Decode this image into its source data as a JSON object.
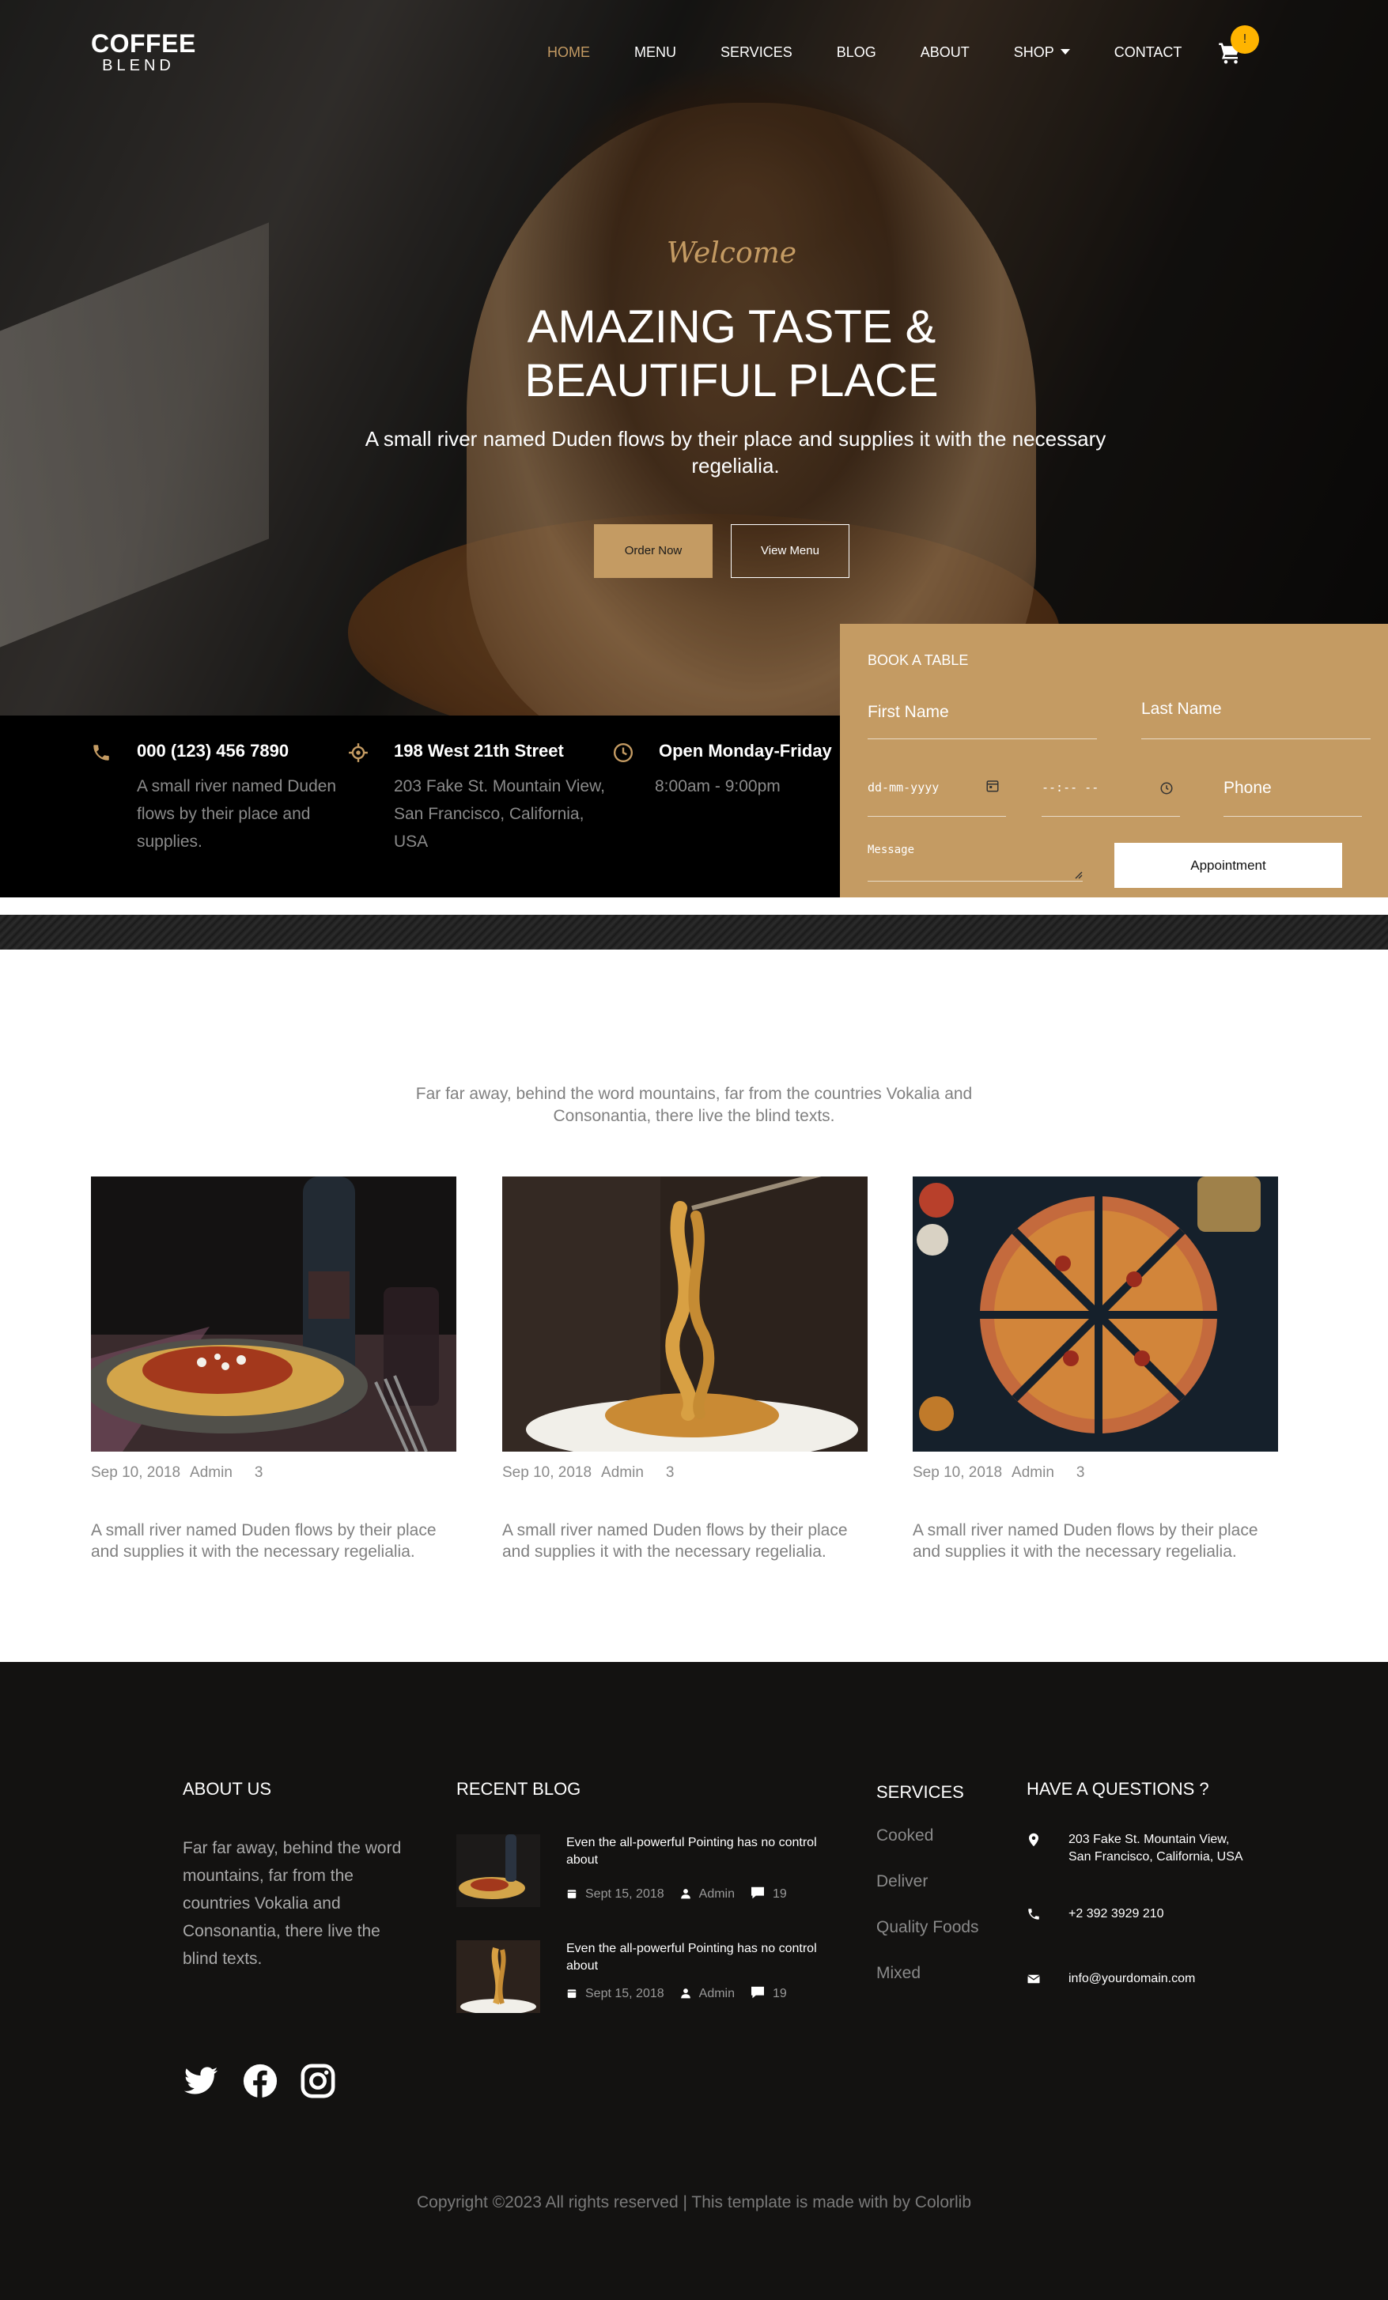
{
  "brand": {
    "line1": "COFFEE",
    "line2": "BLEND"
  },
  "nav": {
    "items": [
      {
        "label": "HOME",
        "active": true
      },
      {
        "label": "MENU"
      },
      {
        "label": "SERVICES"
      },
      {
        "label": "BLOG"
      },
      {
        "label": "ABOUT"
      },
      {
        "label": "SHOP"
      },
      {
        "label": "CONTACT"
      }
    ],
    "cart_count": "!"
  },
  "hero": {
    "welcome": "Welcome",
    "title": "AMAZING TASTE & BEAUTIFUL PLACE",
    "subtitle": "A small river named Duden flows by their place and supplies it with the necessary regelialia.",
    "order_button": "Order Now",
    "menu_button": "View Menu"
  },
  "info": [
    {
      "title": "000 (123) 456 7890",
      "desc": "A small river named Duden flows by their place and supplies."
    },
    {
      "title": "198 West 21th Street",
      "desc": "203 Fake St. Mountain View, San Francisco, California, USA"
    },
    {
      "title": "Open Monday-Friday",
      "desc": "8:00am - 9:00pm"
    }
  ],
  "booking": {
    "title": "BOOK A TABLE",
    "first_name": "First Name",
    "last_name": "Last Name",
    "date": "dd-mm-yyyy",
    "time": "--:-- --",
    "phone": "Phone",
    "message": "Message",
    "button": "Appointment"
  },
  "blog": {
    "intro": "Far far away, behind the word mountains, far from the countries Vokalia and Consonantia, there live the blind texts.",
    "posts": [
      {
        "date": "Sep 10, 2018",
        "author": "Admin",
        "comments": "3",
        "text": "A small river named Duden flows by their place and supplies it with the necessary regelialia."
      },
      {
        "date": "Sep 10, 2018",
        "author": "Admin",
        "comments": "3",
        "text": "A small river named Duden flows by their place and supplies it with the necessary regelialia."
      },
      {
        "date": "Sep 10, 2018",
        "author": "Admin",
        "comments": "3",
        "text": "A small river named Duden flows by their place and supplies it with the necessary regelialia."
      }
    ]
  },
  "footer": {
    "about_heading": "ABOUT US",
    "about_text": "Far far away, behind the word mountains, far from the countries Vokalia and Consonantia, there live the blind texts.",
    "recent_heading": "RECENT BLOG",
    "recent": [
      {
        "title": "Even the all-powerful Pointing has no control about",
        "date": "Sept 15, 2018",
        "author": "Admin",
        "comments": "19"
      },
      {
        "title": "Even the all-powerful Pointing has no control about",
        "date": "Sept 15, 2018",
        "author": "Admin",
        "comments": "19"
      }
    ],
    "services_heading": "SERVICES",
    "services": [
      "Cooked",
      "Deliver",
      "Quality Foods",
      "Mixed"
    ],
    "contact_heading": "HAVE A QUESTIONS ?",
    "address": "203 Fake St. Mountain View, San Francisco, California, USA",
    "phone": "+2 392 3929 210",
    "email": "info@yourdomain.com",
    "social": [
      "twitter-icon",
      "facebook-icon",
      "instagram-icon"
    ],
    "copyright": "Copyright ©2023 All rights reserved | This template is made with by Colorlib"
  },
  "colors": {
    "accent": "#c49b63",
    "badge": "#ffb400",
    "footer_bg": "#131211",
    "info_bg": "#000000"
  }
}
